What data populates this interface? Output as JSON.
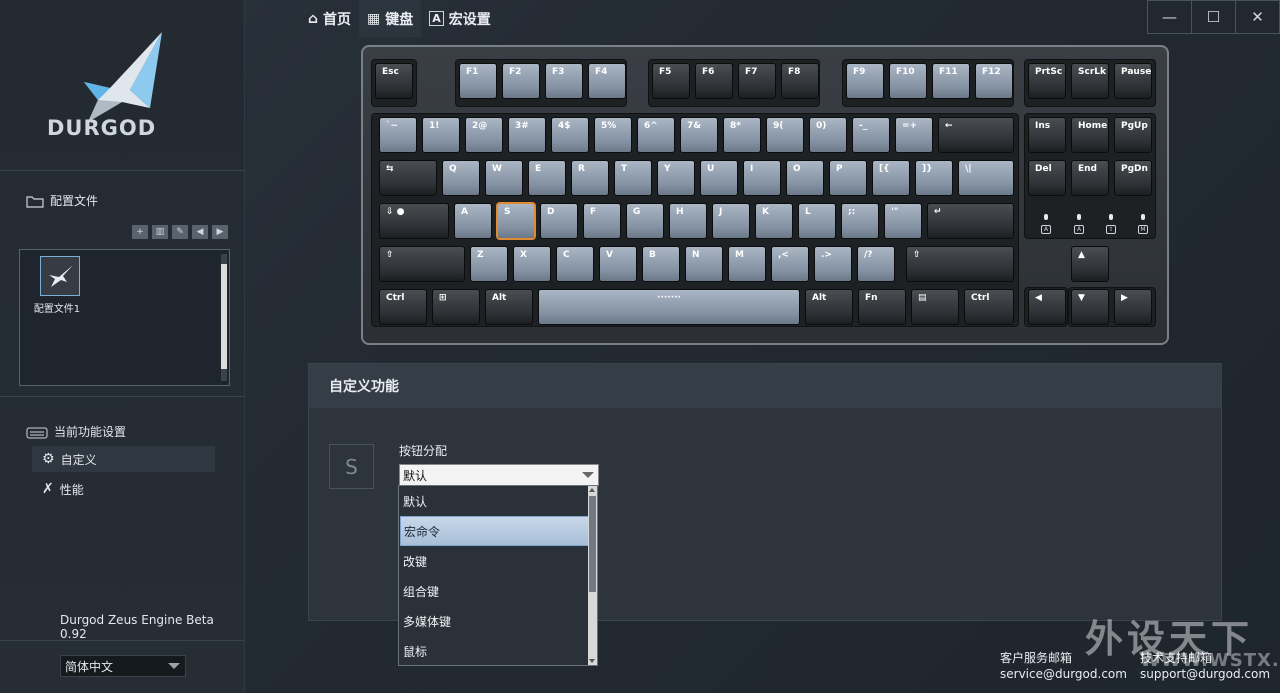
{
  "brand": {
    "name": "DURGOD"
  },
  "nav": {
    "tabs": [
      {
        "label": "首页",
        "icon": "home-icon"
      },
      {
        "label": "键盘",
        "icon": "keyboard-icon"
      },
      {
        "label": "宏设置",
        "icon": "macro-icon"
      }
    ]
  },
  "window": {
    "minimize": "—",
    "maximize": "☐",
    "close": "✕"
  },
  "sidebar": {
    "profiles_title": "配置文件",
    "profiles": [
      {
        "label": "配置文件1"
      }
    ],
    "current_settings_title": "当前功能设置",
    "menu": [
      {
        "label": "自定义",
        "icon": "gear-icon"
      },
      {
        "label": "性能",
        "icon": "wrench-icon"
      }
    ],
    "version": "Durgod Zeus Engine Beta 0.92",
    "language": "简体中文"
  },
  "keyboard": {
    "selected_key": "S",
    "rows": [
      [
        "Esc",
        "F1",
        "F2",
        "F3",
        "F4",
        "F5",
        "F6",
        "F7",
        "F8",
        "F9",
        "F10",
        "F11",
        "F12",
        "PrtSc",
        "ScrLk",
        "Pause"
      ],
      [
        "`~",
        "1!",
        "2@",
        "3#",
        "4$",
        "5%",
        "6^",
        "7&",
        "8*",
        "9(",
        "0)",
        "-_",
        "=+",
        "←",
        "Ins",
        "Home",
        "PgUp"
      ],
      [
        "⇆",
        "Q",
        "W",
        "E",
        "R",
        "T",
        "Y",
        "U",
        "I",
        "O",
        "P",
        "[{",
        "]}",
        "\\|",
        "Del",
        "End",
        "PgDn"
      ],
      [
        "⇩ ●",
        "A",
        "S",
        "D",
        "F",
        "G",
        "H",
        "J",
        "K",
        "L",
        ";:",
        "'\"",
        "↵"
      ],
      [
        "⇧",
        "Z",
        "X",
        "C",
        "V",
        "B",
        "N",
        "M",
        ",<",
        ".>",
        "/?",
        "⇧",
        "▲"
      ],
      [
        "Ctrl",
        "⊞",
        "Alt",
        "",
        "Alt",
        "Fn",
        "▤",
        "Ctrl",
        "◀",
        "▼",
        "▶"
      ]
    ],
    "space_label": "·······",
    "led_labels": [
      "A",
      "A",
      "⇧",
      "M"
    ]
  },
  "panel": {
    "title": "自定义功能",
    "key_preview": "S",
    "assign_label": "按钮分配",
    "selected_value": "默认",
    "options": [
      "默认",
      "宏命令",
      "改键",
      "组合键",
      "多媒体键",
      "鼠标"
    ],
    "highlighted_option": "宏命令"
  },
  "footer": {
    "service_title": "客户服务邮箱",
    "service_email": "service@durgod.com",
    "support_title": "技术支持邮箱",
    "support_email": "support@durgod.com"
  },
  "watermark": {
    "text": "外设天下",
    "url": "WWW.WSTX.COM"
  },
  "colors": {
    "accent_select": "#e08a32",
    "key_light": "#8391a2",
    "key_dark": "#2d3034",
    "highlight": "#a8bfd8"
  }
}
